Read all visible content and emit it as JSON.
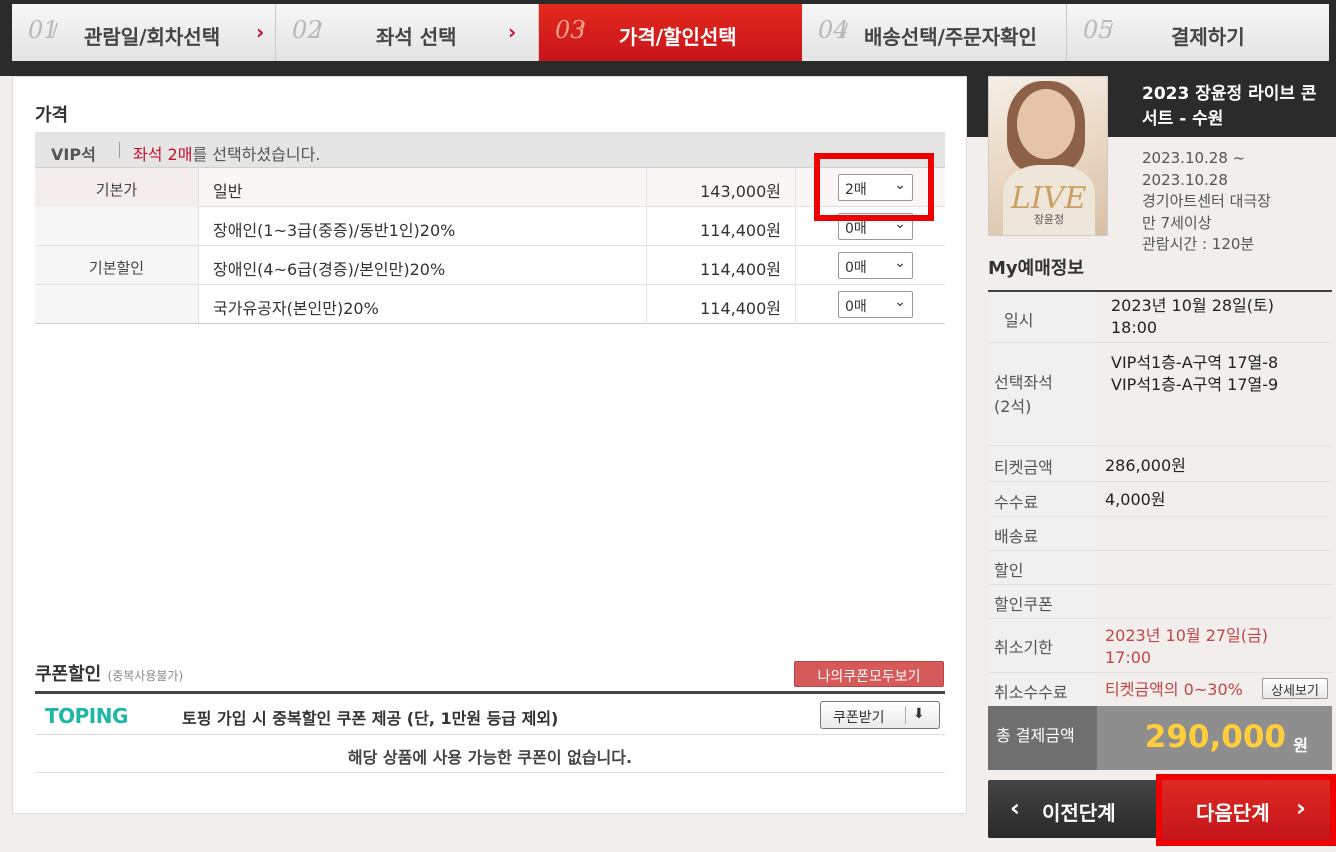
{
  "steps": [
    {
      "num": "01",
      "label": "관람일/회차선택",
      "chev": "›"
    },
    {
      "num": "02",
      "label": "좌석 선택",
      "chev": "›"
    },
    {
      "num": "03",
      "label": "가격/할인선택"
    },
    {
      "num": "04",
      "label": "배송선택/주문자확인"
    },
    {
      "num": "05",
      "label": "결제하기"
    }
  ],
  "price": {
    "title": "가격",
    "grade": "VIP석",
    "msg_prefix": "좌석 2매",
    "msg_suffix": "를 선택하셨습니다.",
    "categories": {
      "base": "기본가",
      "discount": "기본할인"
    },
    "rows": [
      {
        "name": "일반",
        "price": "143,000원",
        "qty": "2매"
      },
      {
        "name": "장애인(1~3급(중증)/동반1인)20%",
        "price": "114,400원",
        "qty": "0매"
      },
      {
        "name": "장애인(4~6급(경증)/본인만)20%",
        "price": "114,400원",
        "qty": "0매"
      },
      {
        "name": "국가유공자(본인만)20%",
        "price": "114,400원",
        "qty": "0매"
      }
    ]
  },
  "coupon": {
    "title": "쿠폰할인",
    "note": "(중복사용불가)",
    "view_all": "나의쿠폰모두보기",
    "logo": "TOPING",
    "desc": "토핑 가입 시 중복할인 쿠폰 제공 (단, 1만원 등급 제외)",
    "get_btn": "쿠폰받기",
    "empty": "해당 상품에 사용 가능한 쿠폰이 없습니다."
  },
  "show": {
    "title": "2023 장윤정 라이브 콘서트 - 수원",
    "period_start": "2023.10.28 ~",
    "period_end": "2023.10.28",
    "venue": "경기아트센터 대극장",
    "age": "만 7세이상",
    "runtime": "관람시간 : 120분",
    "poster_text": "LIVE",
    "poster_name": "장윤정"
  },
  "myinfo": {
    "title": "My예매정보",
    "rows": [
      {
        "k": "일시",
        "v1": "2023년 10월 28일(토)",
        "v2": "18:00"
      },
      {
        "k": "선택좌석",
        "k2": "(2석)",
        "v1": "VIP석1층-A구역 17열-8",
        "v2": "VIP석1층-A구역 17열-9"
      },
      {
        "k": "티켓금액",
        "v1": "286,000원"
      },
      {
        "k": "수수료",
        "v1": "4,000원"
      },
      {
        "k": "배송료",
        "v1": ""
      },
      {
        "k": "할인",
        "v1": ""
      },
      {
        "k": "할인쿠폰",
        "v1": ""
      },
      {
        "k": "취소기한",
        "v1": "2023년 10월 27일(금)",
        "v2": "17:00"
      },
      {
        "k": "취소수수료",
        "v1": "티켓금액의 0~30%",
        "btn": "상세보기"
      }
    ],
    "total_label": "총 결제금액",
    "total_amount": "290,000",
    "total_unit": "원"
  },
  "nav": {
    "prev": "이전단계",
    "next": "다음단계",
    "prev_icon": "‹",
    "next_icon": "›"
  },
  "colors": {
    "accent": "#c8102e",
    "highlight": "#ee0000",
    "total": "#ffce3a"
  }
}
